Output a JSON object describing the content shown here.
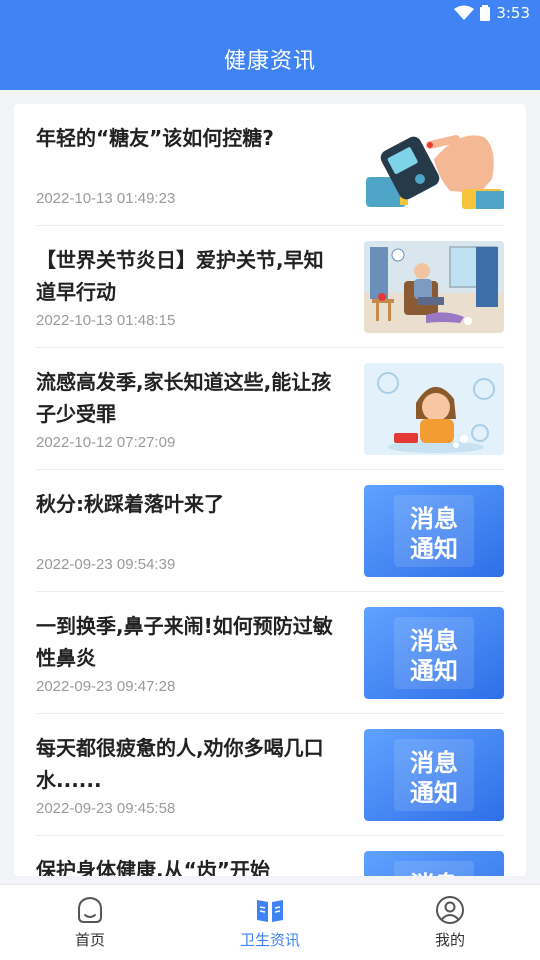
{
  "status_bar": {
    "time": "3:53",
    "wifi_icon": "wifi-icon",
    "battery_icon": "battery-icon"
  },
  "header": {
    "title": "健康资讯"
  },
  "news": [
    {
      "title": "年轻的“糖友”该如何控糖?",
      "time": "2022-10-13 01:49:23",
      "image": "glucose-meter-illustration"
    },
    {
      "title": "【世界关节炎日】爱护关节,早知道早行动",
      "time": "2022-10-13 01:48:15",
      "image": "elderly-knee-pain-illustration"
    },
    {
      "title": "流感高发季,家长知道这些,能让孩子少受罪",
      "time": "2022-10-12 07:27:09",
      "image": "sick-child-illustration"
    },
    {
      "title": "秋分:秋踩着落叶来了",
      "time": "2022-09-23 09:54:39",
      "image": "message-notice-banner",
      "image_text": [
        "消息",
        "通知"
      ]
    },
    {
      "title": "一到换季,鼻子来闹!如何预防过敏性鼻炎",
      "time": "2022-09-23 09:47:28",
      "image": "message-notice-banner",
      "image_text": [
        "消息",
        "通知"
      ]
    },
    {
      "title": "每天都很疲惫的人,劝你多喝几口水......",
      "time": "2022-09-23 09:45:58",
      "image": "message-notice-banner",
      "image_text": [
        "消息",
        "通知"
      ]
    },
    {
      "title": "保护身体健康,从“齿”开始",
      "time": "",
      "image": "message-notice-banner",
      "image_text": [
        "消息",
        "通知"
      ]
    }
  ],
  "tabbar": {
    "items": [
      {
        "label": "首页",
        "icon": "home-icon",
        "active": false
      },
      {
        "label": "卫生资讯",
        "icon": "book-icon",
        "active": true
      },
      {
        "label": "我的",
        "icon": "profile-icon",
        "active": false
      }
    ]
  },
  "colors": {
    "primary": "#3f83f4",
    "title_text": "#222222",
    "time_text": "#9a9a9a"
  }
}
